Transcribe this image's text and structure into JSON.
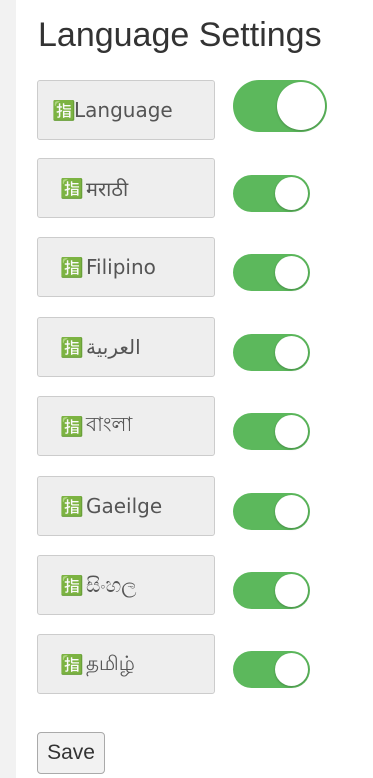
{
  "page": {
    "title": "Language Settings",
    "save_label": "Save"
  },
  "icon": "translate-icon",
  "languages": [
    {
      "label": "Language",
      "enabled": true
    },
    {
      "label": "मराठी",
      "enabled": true
    },
    {
      "label": "Filipino",
      "enabled": true
    },
    {
      "label": "العربية",
      "enabled": true
    },
    {
      "label": "বাংলা",
      "enabled": true
    },
    {
      "label": "Gaeilge",
      "enabled": true
    },
    {
      "label": "සිංහල",
      "enabled": true
    },
    {
      "label": "தமிழ்",
      "enabled": true
    }
  ],
  "colors": {
    "toggle_on": "#5cb85c",
    "label_bg": "#eeeeee"
  }
}
